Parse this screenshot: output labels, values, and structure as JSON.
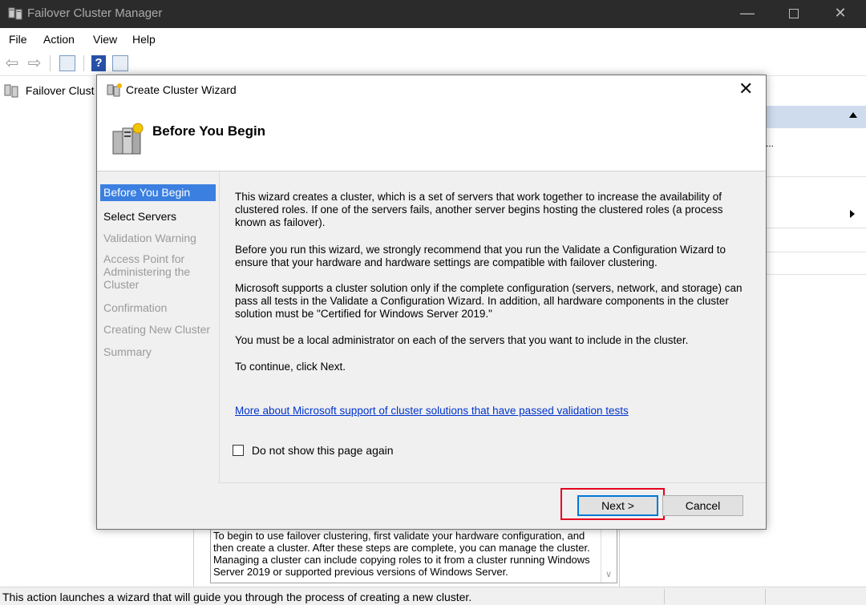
{
  "window": {
    "title": "Failover Cluster Manager",
    "icon": "cluster-manager-icon"
  },
  "menu": [
    "File",
    "Action",
    "View",
    "Help"
  ],
  "tree": {
    "root_label": "Failover Clust"
  },
  "help_panel": {
    "text": "To begin to use failover clustering, first validate your hardware configuration, and then create a cluster.  After these steps are complete, you can manage the cluster. Managing a cluster can include copying roles to it from a cluster running Windows Server 2019 or supported previous versions of Windows Server."
  },
  "actions_pane": {
    "ellipsis": "..."
  },
  "status_bar": {
    "text": "This action launches a wizard that will guide you through the process of creating a new cluster."
  },
  "dialog": {
    "title": "Create Cluster Wizard",
    "header": "Before You Begin",
    "steps": [
      {
        "label": "Before You Begin",
        "state": "active"
      },
      {
        "label": "Select Servers",
        "state": "normal"
      },
      {
        "label": "Validation Warning",
        "state": "disabled"
      },
      {
        "label": "Access Point for Administering the Cluster",
        "state": "disabled"
      },
      {
        "label": "Confirmation",
        "state": "disabled"
      },
      {
        "label": "Creating New Cluster",
        "state": "disabled"
      },
      {
        "label": "Summary",
        "state": "disabled"
      }
    ],
    "paragraphs": [
      "This wizard creates a cluster, which is a set of servers that work together to increase the availability of clustered roles. If one of the servers fails, another server begins hosting the clustered roles (a process known as failover).",
      "Before you run this wizard, we strongly recommend that you run the Validate a Configuration Wizard to ensure that your hardware and hardware settings are compatible with failover clustering.",
      "Microsoft supports a cluster solution only if the complete configuration (servers, network, and storage) can pass all tests in the Validate a Configuration Wizard. In addition, all hardware components in the cluster solution must be \"Certified for Windows Server 2019.\"",
      "You must be a local administrator on each of the servers that you want to include in the cluster.",
      "To continue, click Next."
    ],
    "link": "More about Microsoft support of cluster solutions that have passed validation tests",
    "checkbox_label": "Do not show this page again",
    "checkbox_checked": false,
    "next_label": "Next >",
    "cancel_label": "Cancel",
    "highlight_color": "#e6001e"
  }
}
